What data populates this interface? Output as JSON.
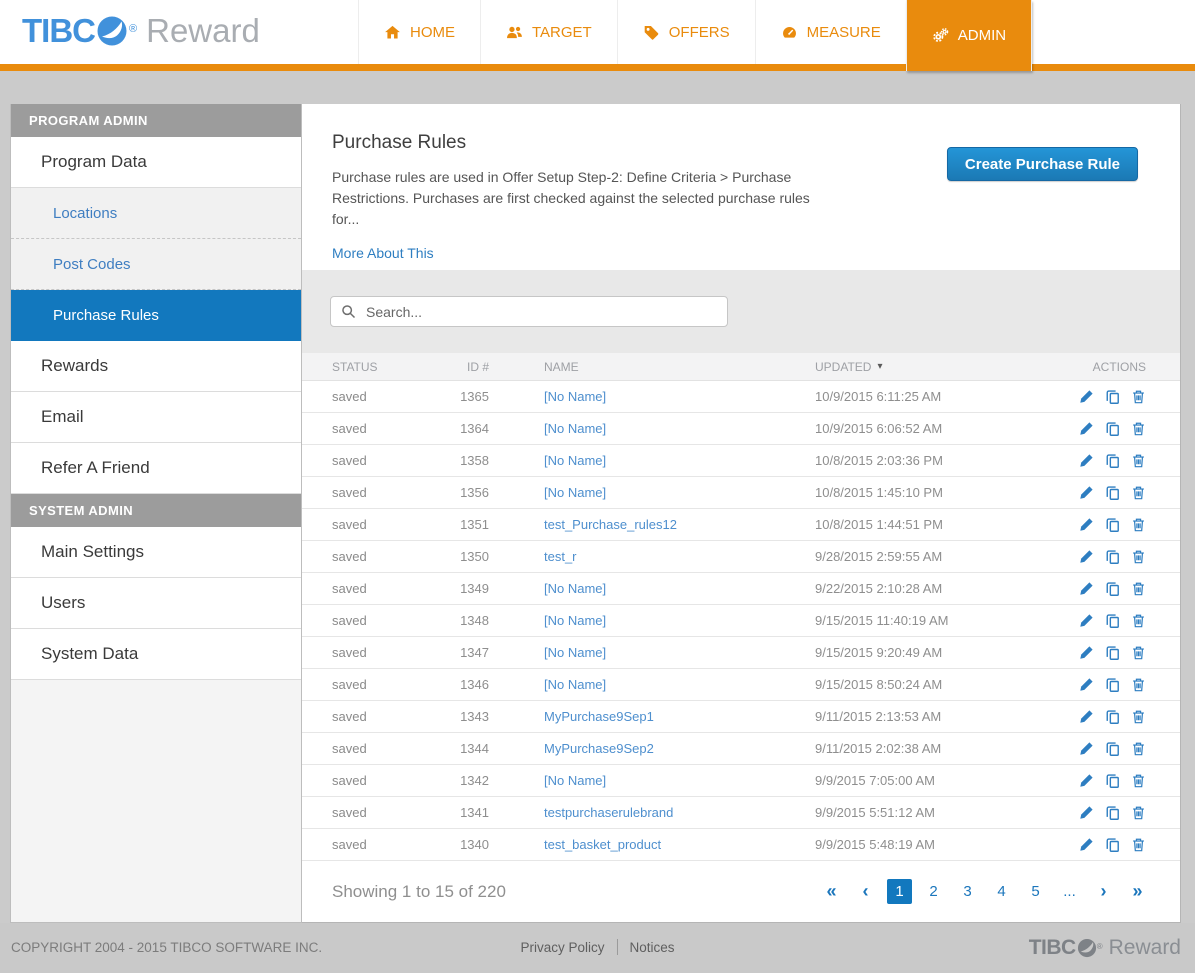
{
  "header": {
    "brand_prefix": "TIBC",
    "brand_registered": "®",
    "brand_suffix": "Reward",
    "nav_tabs": [
      {
        "label": "HOME"
      },
      {
        "label": "TARGET"
      },
      {
        "label": "OFFERS"
      },
      {
        "label": "MEASURE"
      },
      {
        "label": "ADMIN"
      }
    ]
  },
  "sidebar": {
    "program_admin_label": "PROGRAM ADMIN",
    "system_admin_label": "SYSTEM ADMIN",
    "items": [
      "Program Data",
      "Locations",
      "Post Codes",
      "Purchase Rules",
      "Rewards",
      "Email",
      "Refer A Friend",
      "Main Settings",
      "Users",
      "System Data"
    ],
    "active_item": "Purchase Rules"
  },
  "main": {
    "title": "Purchase Rules",
    "description": "Purchase rules are used in Offer Setup Step-2: Define Criteria > Purchase Restrictions. Purchases are first checked against the selected purchase rules for...",
    "more_link": "More About This",
    "create_button": "Create Purchase Rule",
    "search": {
      "placeholder": "Search..."
    }
  },
  "table": {
    "headers": {
      "status": "STATUS",
      "id": "ID #",
      "name": "NAME",
      "updated": "UPDATED",
      "actions": "ACTIONS"
    },
    "sort_column": "UPDATED",
    "sort_direction": "desc",
    "rows": [
      {
        "status": "saved",
        "id": "1365",
        "name": "[No Name]",
        "updated": "10/9/2015 6:11:25 AM"
      },
      {
        "status": "saved",
        "id": "1364",
        "name": "[No Name]",
        "updated": "10/9/2015 6:06:52 AM"
      },
      {
        "status": "saved",
        "id": "1358",
        "name": "[No Name]",
        "updated": "10/8/2015 2:03:36 PM"
      },
      {
        "status": "saved",
        "id": "1356",
        "name": "[No Name]",
        "updated": "10/8/2015 1:45:10 PM"
      },
      {
        "status": "saved",
        "id": "1351",
        "name": "test_Purchase_rules12",
        "updated": "10/8/2015 1:44:51 PM"
      },
      {
        "status": "saved",
        "id": "1350",
        "name": "test_r",
        "updated": "9/28/2015 2:59:55 AM"
      },
      {
        "status": "saved",
        "id": "1349",
        "name": "[No Name]",
        "updated": "9/22/2015 2:10:28 AM"
      },
      {
        "status": "saved",
        "id": "1348",
        "name": "[No Name]",
        "updated": "9/15/2015 11:40:19 AM"
      },
      {
        "status": "saved",
        "id": "1347",
        "name": "[No Name]",
        "updated": "9/15/2015 9:20:49 AM"
      },
      {
        "status": "saved",
        "id": "1346",
        "name": "[No Name]",
        "updated": "9/15/2015 8:50:24 AM"
      },
      {
        "status": "saved",
        "id": "1343",
        "name": "MyPurchase9Sep1",
        "updated": "9/11/2015 2:13:53 AM"
      },
      {
        "status": "saved",
        "id": "1344",
        "name": "MyPurchase9Sep2",
        "updated": "9/11/2015 2:02:38 AM"
      },
      {
        "status": "saved",
        "id": "1342",
        "name": "[No Name]",
        "updated": "9/9/2015 7:05:00 AM"
      },
      {
        "status": "saved",
        "id": "1341",
        "name": "testpurchaserulebrand",
        "updated": "9/9/2015 5:51:12 AM"
      },
      {
        "status": "saved",
        "id": "1340",
        "name": "test_basket_product",
        "updated": "9/9/2015 5:48:19 AM"
      }
    ]
  },
  "pagination": {
    "summary": "Showing 1 to 15 of 220",
    "first": "«",
    "prev": "‹",
    "pages": [
      "1",
      "2",
      "3",
      "4",
      "5"
    ],
    "active_page": "1",
    "ellipsis": "...",
    "next": "›",
    "last": "»"
  },
  "footer": {
    "copyright": "COPYRIGHT 2004 - 2015 TIBCO SOFTWARE INC.",
    "privacy_link": "Privacy Policy",
    "notices_link": "Notices",
    "brand_prefix": "TIBC",
    "brand_registered": "®",
    "brand_suffix": "Reward"
  },
  "colors": {
    "accent_orange": "#E98B0D",
    "accent_blue": "#1278BE",
    "link_blue": "#3F7EC1",
    "pager_blue": "#1B76BC"
  }
}
